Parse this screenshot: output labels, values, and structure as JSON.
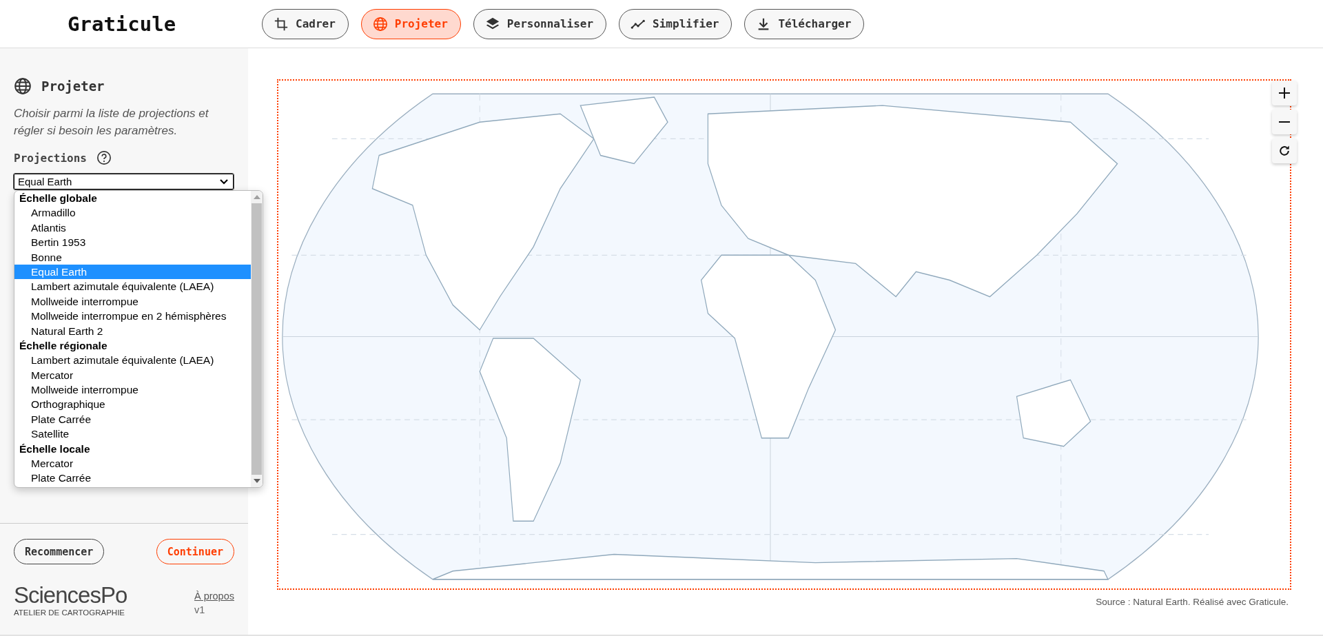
{
  "header": {
    "logo": "Graticule",
    "nav": [
      {
        "label": "Cadrer",
        "selected": false
      },
      {
        "label": "Projeter",
        "selected": true
      },
      {
        "label": "Personnaliser",
        "selected": false
      },
      {
        "label": "Simplifier",
        "selected": false
      },
      {
        "label": "Télécharger",
        "selected": false
      }
    ]
  },
  "sidebar": {
    "title": "Projeter",
    "description": "Choisir parmi la liste de projections et régler si besoin les paramètres.",
    "projections_label": "Projections",
    "select": {
      "value": "Equal Earth",
      "expanded": true
    },
    "dropdown": [
      {
        "label": "Échelle globale",
        "options": [
          {
            "label": "Armadillo",
            "selected": false
          },
          {
            "label": "Atlantis",
            "selected": false
          },
          {
            "label": "Bertin 1953",
            "selected": false
          },
          {
            "label": "Bonne",
            "selected": false
          },
          {
            "label": "Equal Earth",
            "selected": true
          },
          {
            "label": "Lambert azimutale équivalente (LAEA)",
            "selected": false
          },
          {
            "label": "Mollweide interrompue",
            "selected": false
          },
          {
            "label": "Mollweide interrompue en 2 hémisphères",
            "selected": false
          },
          {
            "label": "Natural Earth 2",
            "selected": false
          }
        ]
      },
      {
        "label": "Échelle régionale",
        "options": [
          {
            "label": "Lambert azimutale équivalente (LAEA)",
            "selected": false
          },
          {
            "label": "Mercator",
            "selected": false
          },
          {
            "label": "Mollweide interrompue",
            "selected": false
          },
          {
            "label": "Orthographique",
            "selected": false
          },
          {
            "label": "Plate Carrée",
            "selected": false
          },
          {
            "label": "Satellite",
            "selected": false
          }
        ]
      },
      {
        "label": "Échelle locale",
        "options": [
          {
            "label": "Mercator",
            "selected": false
          },
          {
            "label": "Plate Carrée",
            "selected": false
          }
        ]
      }
    ],
    "buttons": [
      {
        "label": "Recommencer",
        "kind": "secondary"
      },
      {
        "label": "Continuer",
        "kind": "primary"
      }
    ],
    "brand": {
      "name": "SciencesPo",
      "subtitle": "ATELIER DE CARTOGRAPHIE"
    },
    "about_link": "À propos",
    "version": "v1"
  },
  "map": {
    "source": "Source : Natural Earth. Réalisé avec Graticule."
  }
}
